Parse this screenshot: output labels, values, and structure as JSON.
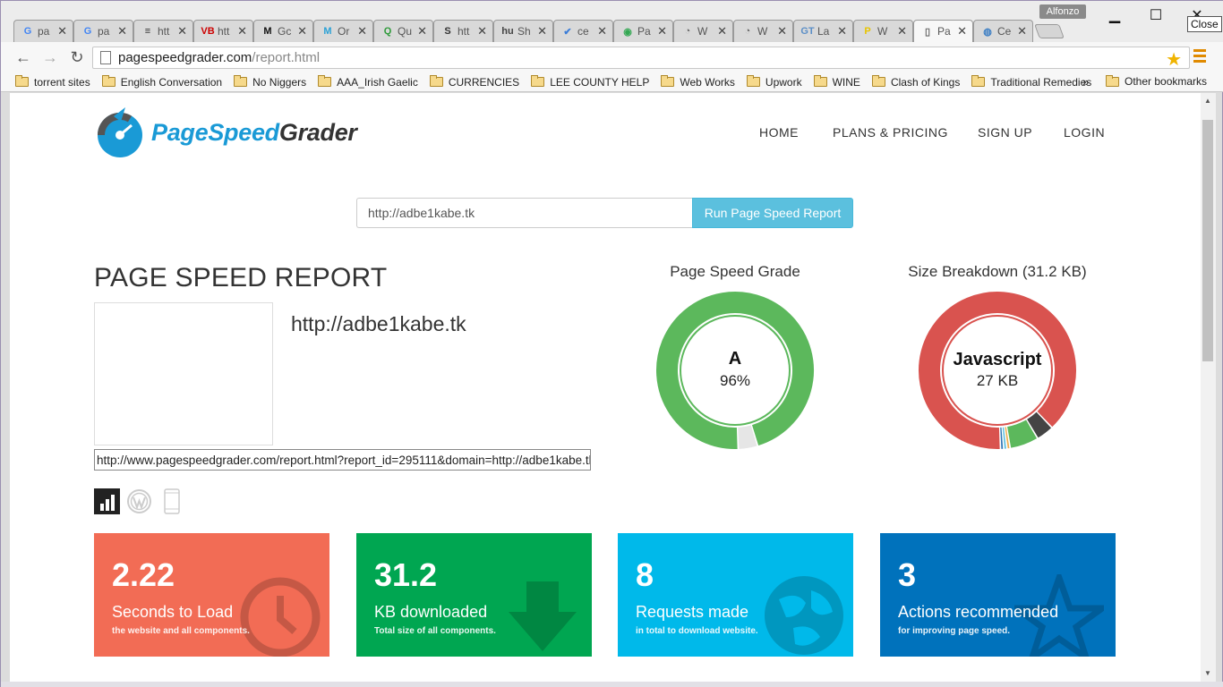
{
  "browser": {
    "tabs": [
      {
        "label": "pa",
        "icon": "google-icon",
        "fav": "G",
        "fav_color": "#4285f4"
      },
      {
        "label": "pa",
        "icon": "google-icon",
        "fav": "G",
        "fav_color": "#4285f4"
      },
      {
        "label": "htt",
        "icon": "layers-icon",
        "fav": "≡",
        "fav_color": "#333333"
      },
      {
        "label": "htt",
        "icon": "vb-icon",
        "fav": "VB",
        "fav_color": "#cc0000"
      },
      {
        "label": "Gc",
        "icon": "m-icon",
        "fav": "M",
        "fav_color": "#111111"
      },
      {
        "label": "Or",
        "icon": "m-blue-icon",
        "fav": "M",
        "fav_color": "#2aa1d6"
      },
      {
        "label": "Qu",
        "icon": "q-icon",
        "fav": "Q",
        "fav_color": "#2e9a3a"
      },
      {
        "label": "htt",
        "icon": "s-icon",
        "fav": "S",
        "fav_color": "#333333"
      },
      {
        "label": "Sh",
        "icon": "hu-icon",
        "fav": "hu",
        "fav_color": "#444444"
      },
      {
        "label": "ce",
        "icon": "check-icon",
        "fav": "✔",
        "fav_color": "#3b7dd8"
      },
      {
        "label": "Pa",
        "icon": "chrome-icon",
        "fav": "◉",
        "fav_color": "#34a853"
      },
      {
        "label": "W",
        "icon": "gauge-tab-icon",
        "fav": "◔",
        "fav_color": "#666666"
      },
      {
        "label": "W",
        "icon": "gauge-tab-icon",
        "fav": "◔",
        "fav_color": "#666666"
      },
      {
        "label": "La",
        "icon": "gt-icon",
        "fav": "GT",
        "fav_color": "#5c8fc7"
      },
      {
        "label": "W",
        "icon": "p-icon",
        "fav": "P",
        "fav_color": "#e8c400"
      },
      {
        "label": "Pa",
        "icon": "page-icon",
        "fav": "▯",
        "fav_color": "#666666"
      },
      {
        "label": "Ce",
        "icon": "globe-tab-icon",
        "fav": "◍",
        "fav_color": "#3d7fc4"
      }
    ],
    "profile_name": "Alfonzo",
    "close_tooltip": "Close",
    "address": {
      "host": "pagespeedgrader.com",
      "path": "/report.html"
    },
    "bookmarks": [
      "torrent sites",
      "English Conversation",
      "No Niggers",
      "AAA_Irish Gaelic",
      "CURRENCIES",
      "LEE COUNTY HELP",
      "Web Works",
      "Upwork",
      "WINE",
      "Clash of Kings",
      "Traditional Remedies"
    ],
    "bookmarks_more": "»",
    "other_bookmarks": "Other bookmarks"
  },
  "site": {
    "logo_part1": "PageSpeed",
    "logo_part2": "Grader",
    "nav": [
      "HOME",
      "PLANS & PRICING",
      "SIGN UP",
      "LOGIN"
    ],
    "input_value": "http://adbe1kabe.tk",
    "run_button": "Run Page Speed Report",
    "report_title": "PAGE SPEED REPORT",
    "site_url": "http://adbe1kabe.tk",
    "share_url": "http://www.pagespeedgrader.com/report.html?report_id=295111&domain=http://adbe1kabe.tk"
  },
  "grade": {
    "title": "Page Speed Grade",
    "letter": "A",
    "percent": "96%",
    "value": 96,
    "color": "#5cb85c"
  },
  "size": {
    "title": "Size Breakdown (31.2 KB)",
    "label": "Javascript",
    "value": "27 KB",
    "segments": [
      {
        "name": "Javascript",
        "kb": 27,
        "color": "#d9534f"
      },
      {
        "name": "other-1",
        "kb": 1.1,
        "color": "#444444"
      },
      {
        "name": "other-2",
        "kb": 1.8,
        "color": "#5cb85c"
      },
      {
        "name": "other-3",
        "kb": 0.2,
        "color": "#f0ad4e"
      },
      {
        "name": "other-4",
        "kb": 0.2,
        "color": "#5bc0de"
      },
      {
        "name": "other-5",
        "kb": 0.2,
        "color": "#337ab7"
      }
    ]
  },
  "cards": [
    {
      "num": "2.22",
      "label": "Seconds to Load",
      "sub": "the website and all components.",
      "color": "#f26c55",
      "icon": "clock-icon"
    },
    {
      "num": "31.2",
      "label": "KB downloaded",
      "sub": "Total size of all components.",
      "color": "#00a651",
      "icon": "download-arrow-icon"
    },
    {
      "num": "8",
      "label": "Requests made",
      "sub": "in total to download website.",
      "color": "#00b9ea",
      "icon": "globe-icon"
    },
    {
      "num": "3",
      "label": "Actions recommended",
      "sub": "for improving page speed.",
      "color": "#0072bc",
      "icon": "star-icon"
    }
  ]
}
